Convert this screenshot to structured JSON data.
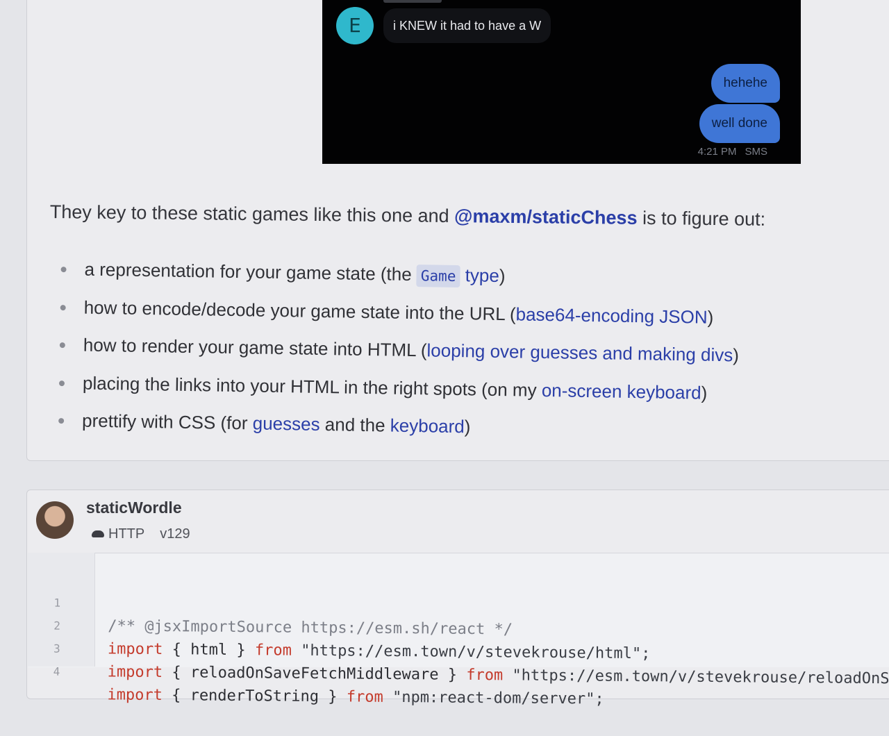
{
  "sms": {
    "sender_initial": "E",
    "incoming_message": "i KNEW it had to have a W",
    "outgoing_messages": [
      "hehehe",
      "well done"
    ],
    "time": "4:21 PM",
    "channel": "SMS"
  },
  "readme": {
    "intro_before": "They key to these static games like this one and ",
    "intro_link": "@maxm/staticChess",
    "intro_after": " is to figure out:",
    "bullets": [
      {
        "text": "a representation for your game state (the ",
        "code": "Game",
        "link": "type",
        "after": ")"
      },
      {
        "text": "how to encode/decode your game state into the URL (",
        "link": "base64-encoding JSON",
        "after": ")"
      },
      {
        "text": "how to render your game state into HTML (",
        "link": "looping over guesses and making divs",
        "after": ")"
      },
      {
        "text": "placing the links into your HTML in the right spots (on my ",
        "link": "on-screen keyboard",
        "after": ")"
      },
      {
        "text": "prettify with CSS (for ",
        "link": "guesses",
        "mid": " and the ",
        "link2": "keyboard",
        "after": ")"
      }
    ]
  },
  "val": {
    "name": "staticWordle",
    "type_icon": "cloud-icon",
    "type": "HTTP",
    "version": "v129"
  },
  "code": {
    "lines": [
      {
        "num": "1",
        "comment": "/** @jsxImportSource https://esm.sh/react */"
      },
      {
        "num": "2",
        "kw": "import",
        "body": " { html } ",
        "kw2": "from",
        "str": " \"https://esm.town/v/stevekrouse/html\";"
      },
      {
        "num": "3",
        "kw": "import",
        "body": " { reloadOnSaveFetchMiddleware } ",
        "kw2": "from",
        "str": " \"https://esm.town/v/stevekrouse/reloadOnS"
      },
      {
        "num": "4",
        "kw": "import",
        "body": " { renderToString } ",
        "kw2": "from",
        "str": " \"npm:react-dom/server\";"
      }
    ]
  },
  "colors": {
    "link": "#2b3fa8",
    "sms_bubble_out": "#3f76d6",
    "avatar_e": "#2fb8cc",
    "keyword": "#c43b2c"
  }
}
